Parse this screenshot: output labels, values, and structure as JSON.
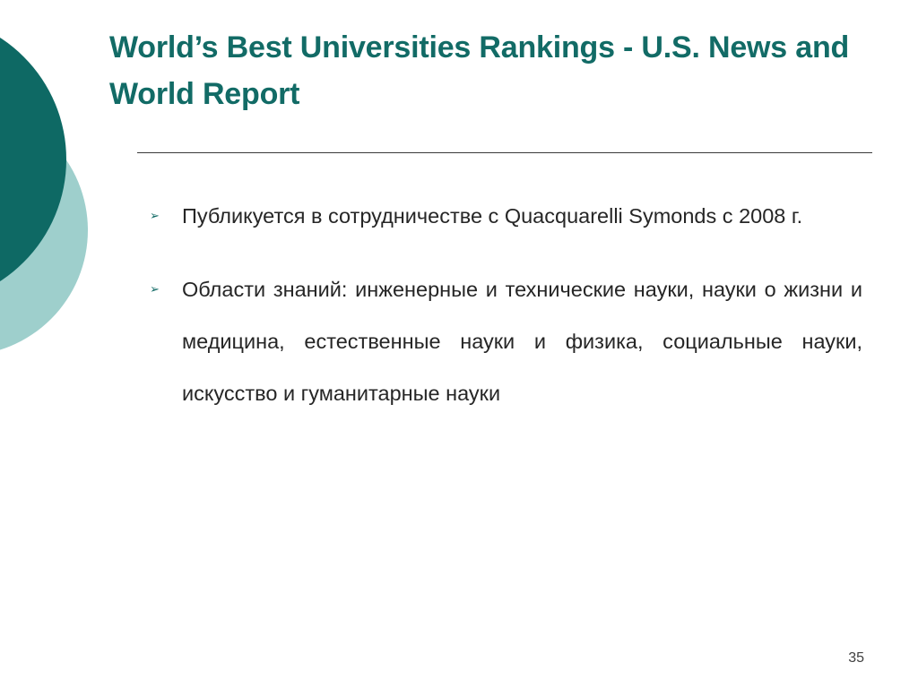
{
  "slide": {
    "title": "World’s Best Universities Rankings - U.S. News and World Report",
    "bullets": [
      {
        "icon": "chevron-right-icon",
        "text": "Публикуется в сотрудничестве с Quacquarelli Symonds с 2008 г."
      },
      {
        "icon": "chevron-right-icon",
        "text": "Области знаний: инженерные и технические науки, науки о жизни и медицина, естественные науки и физика, социальные науки, искусство и гуманитарные науки"
      }
    ],
    "page_number": "35"
  },
  "colors": {
    "accent_dark": "#0e6964",
    "accent_light": "#9ecfcc",
    "title": "#126b66",
    "body_text": "#262626"
  }
}
